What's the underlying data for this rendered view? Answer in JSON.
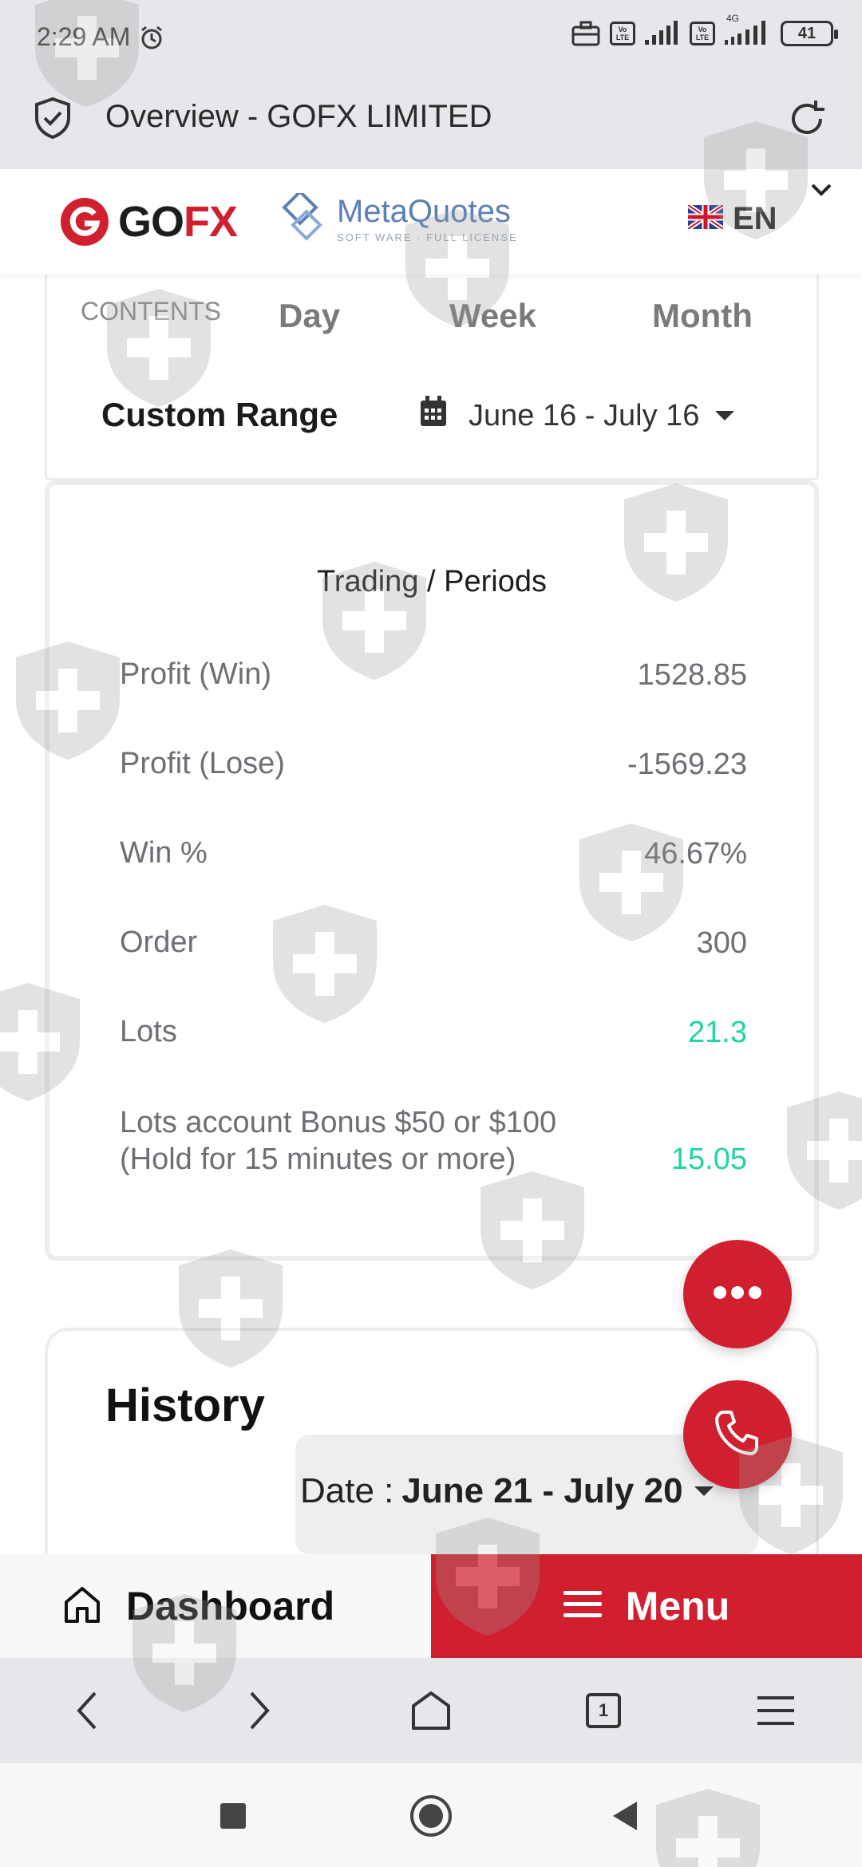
{
  "status_bar": {
    "time": "2:29 AM",
    "battery": "41",
    "network_label": "4G",
    "lte_label": "Vo LTE"
  },
  "browser": {
    "page_title": "Overview - GOFX LIMITED",
    "tab_count": "1"
  },
  "header": {
    "brand": "GOFX",
    "brand_go": "GO",
    "brand_fx": "FX",
    "partner_name": "MetaQuotes",
    "partner_sub": "SOFT WARE · FULL LICENSE",
    "language": "EN"
  },
  "period": {
    "contents_label": "CONTENTS",
    "tabs": [
      "Day",
      "Week",
      "Month"
    ],
    "custom_range_label": "Custom Range",
    "date_range": "June 16 - July 16"
  },
  "stats": {
    "title": "Trading / Periods",
    "rows": [
      {
        "label": "Profit (Win)",
        "value": "1528.85"
      },
      {
        "label": "Profit (Lose)",
        "value": "-1569.23"
      },
      {
        "label": "Win %",
        "value": "46.67%"
      },
      {
        "label": "Order",
        "value": "300"
      },
      {
        "label": "Lots",
        "value": "21.3"
      },
      {
        "label_line1": "Lots account Bonus $50 or $100",
        "label_line2": "(Hold for 15 minutes or more)",
        "value": "15.05"
      }
    ],
    "colors": {
      "value_default": "#6e6e74",
      "value_highlight": "#21d4a5"
    }
  },
  "history": {
    "title": "History",
    "date_prefix": "Date :",
    "date_range": "June 21 - July 20"
  },
  "bottom_nav": {
    "dashboard_label": "Dashboard",
    "menu_label": "Menu"
  },
  "colors": {
    "brand_red": "#d0202f",
    "chrome_gray": "#e6e7ea"
  },
  "icons": [
    "alarm-icon",
    "briefcase-icon",
    "signal-icon",
    "shield-check-icon",
    "reload-icon",
    "uk-flag-icon",
    "calendar-icon",
    "more-icon",
    "phone-icon",
    "home-icon",
    "menu-icon",
    "back-icon",
    "forward-icon",
    "browser-home-icon",
    "tabs-icon",
    "browser-menu-icon",
    "recents-icon",
    "home-circle-icon",
    "nav-back-icon"
  ]
}
